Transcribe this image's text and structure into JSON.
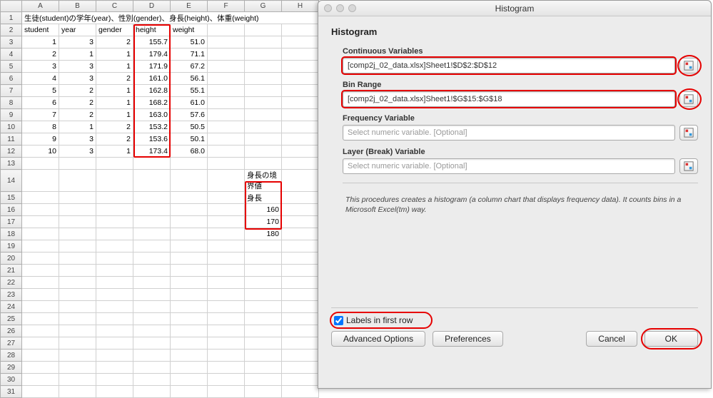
{
  "sheet": {
    "title_row": "生徒(student)の学年(year)、性別(gender)、身長(height)、体重(weight)",
    "columns": [
      "A",
      "B",
      "C",
      "D",
      "E",
      "F",
      "G",
      "H"
    ],
    "headers": [
      "student",
      "year",
      "gender",
      "height",
      "weight"
    ],
    "rows": [
      {
        "student": 1,
        "year": 3,
        "gender": 2,
        "height": "155.7",
        "weight": "51.0"
      },
      {
        "student": 2,
        "year": 1,
        "gender": 1,
        "height": "179.4",
        "weight": "71.1"
      },
      {
        "student": 3,
        "year": 3,
        "gender": 1,
        "height": "171.9",
        "weight": "67.2"
      },
      {
        "student": 4,
        "year": 3,
        "gender": 2,
        "height": "161.0",
        "weight": "56.1"
      },
      {
        "student": 5,
        "year": 2,
        "gender": 1,
        "height": "162.8",
        "weight": "55.1"
      },
      {
        "student": 6,
        "year": 2,
        "gender": 1,
        "height": "168.2",
        "weight": "61.0"
      },
      {
        "student": 7,
        "year": 2,
        "gender": 1,
        "height": "163.0",
        "weight": "57.6"
      },
      {
        "student": 8,
        "year": 1,
        "gender": 2,
        "height": "153.2",
        "weight": "50.5"
      },
      {
        "student": 9,
        "year": 3,
        "gender": 2,
        "height": "153.6",
        "weight": "50.1"
      },
      {
        "student": 10,
        "year": 3,
        "gender": 1,
        "height": "173.4",
        "weight": "68.0"
      }
    ],
    "bins_title": "身長の境界値",
    "bins_header": "身長",
    "bins": [
      160,
      170,
      180
    ]
  },
  "dialog": {
    "window_title": "Histogram",
    "heading": "Histogram",
    "cv_label": "Continuous Variables",
    "cv_value": "[comp2j_02_data.xlsx]Sheet1!$D$2:$D$12",
    "br_label": "Bin Range",
    "br_value": "[comp2j_02_data.xlsx]Sheet1!$G$15:$G$18",
    "fv_label": "Frequency Variable",
    "fv_placeholder": "Select numeric variable. [Optional]",
    "lv_label": "Layer (Break) Variable",
    "lv_placeholder": "Select numeric variable. [Optional]",
    "note": "This procedures creates a histogram (a column chart that displays frequency data). It counts bins in a Microsoft Excel(tm) way.",
    "labels_first_row": "Labels in first row",
    "btn_adv": "Advanced Options",
    "btn_prefs": "Preferences",
    "btn_cancel": "Cancel",
    "btn_ok": "OK"
  }
}
